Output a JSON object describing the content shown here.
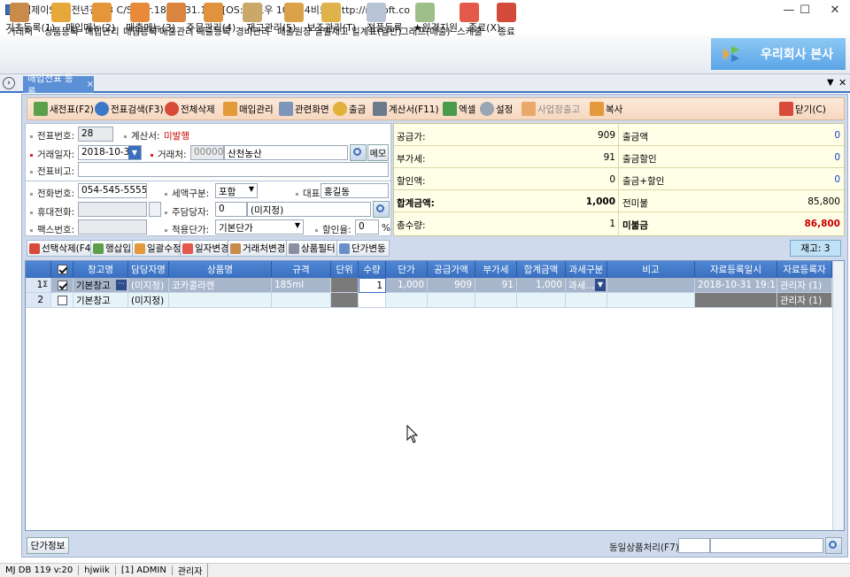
{
  "window": {
    "title": "엠제이Soft 전년경영3 C/S   Ver.18.10.31.179  [OS: 윈도우 10 - 64비트]   http://mjsoft.co"
  },
  "menu": [
    "기초등록(1)",
    "매입메뉴(2)",
    "매출메뉴(3)",
    "주문관리(4)",
    "재고관리(5)",
    "보조관리(T)",
    "정품등록",
    "★원격지원",
    "종료(X)"
  ],
  "toolbar": [
    "거래처",
    "상품등록",
    "매입관리",
    "매입등록",
    "매출관리",
    "매출등록",
    "경비관리",
    "매출원장",
    "일별재고",
    "일계표(일반)",
    "그래프(매출)",
    "스케줄",
    "종료"
  ],
  "brand": {
    "label": "우리회사 본사"
  },
  "tab": {
    "label": "매입전표 등록",
    "close": "×"
  },
  "form_toolbar": [
    "새전표(F2)",
    "전표검색(F3)",
    "전체삭제",
    "매입관리",
    "관련화면",
    "출금",
    "계산서(F11)",
    "엑셀",
    "설정",
    "사업장출고",
    "복사",
    "닫기(C)"
  ],
  "form": {
    "voucher_no_label": "전표번호:",
    "voucher_no": "28",
    "invoice_label": "계산서:",
    "invoice_status": "미발행",
    "date_label": "거래일자:",
    "date": "2018-10-31",
    "vendor_label": "거래처:",
    "vendor_code": "000001",
    "vendor_name": "산천농산",
    "memo_btn": "메모",
    "note_label": "전표비고:",
    "note": "",
    "phone_label": "전화번호:",
    "phone": "054-545-5555",
    "tax_type_label": "세액구분:",
    "tax_type": "포함",
    "rep_label": "대표자:",
    "rep": "홍길동",
    "mobile_label": "휴대전화:",
    "mobile": "",
    "manager_label": "주담당자:",
    "manager_code": "0",
    "manager_name": "(미지정)",
    "fax_label": "팩스번호:",
    "fax": "",
    "price_type_label": "적용단가:",
    "price_type": "기본단가",
    "discount_label": "할인율:",
    "discount": "0",
    "percent": "%"
  },
  "summary": [
    {
      "left_label": "공급가:",
      "left_value": "909",
      "right_label": "출금액",
      "right_value": "0"
    },
    {
      "left_label": "부가세:",
      "left_value": "91",
      "right_label": "출금할인",
      "right_value": "0"
    },
    {
      "left_label": "할인액:",
      "left_value": "0",
      "right_label": "출금+할인",
      "right_value": "0"
    },
    {
      "left_label": "합계금액:",
      "left_value": "1,000",
      "right_label": "전미불",
      "right_value": "85,800"
    },
    {
      "left_label": "총수량:",
      "left_value": "1",
      "right_label": "미불금",
      "right_value": "86,800"
    }
  ],
  "actions": [
    "선택삭제(F4)",
    "행삽입",
    "일괄수정",
    "일자변경",
    "거래처변경",
    "상품필터",
    "단가변동"
  ],
  "stock": "재고: 3",
  "grid": {
    "headers": [
      "",
      "",
      "창고명",
      "담당자명",
      "상품명",
      "규격",
      "단위",
      "수량",
      "단가",
      "공급가액",
      "부가세",
      "합계금액",
      "과세구분",
      "비고",
      "자료등록일시",
      "자료등록자"
    ],
    "rows": [
      {
        "no": "1",
        "mark": "Σ",
        "checked": true,
        "warehouse": "기본창고",
        "manager": "(미지정)",
        "product": "코카콜라캔",
        "spec": "185ml",
        "unit": "",
        "qty": "1",
        "price": "1,000",
        "supply": "909",
        "vat": "91",
        "total": "1,000",
        "tax": "과세...",
        "note": "",
        "reg_date": "2018-10-31 19:11:05",
        "reg_user": "관리자 (1)"
      },
      {
        "no": "2",
        "mark": "",
        "checked": false,
        "warehouse": "기본창고",
        "manager": "(미지정)",
        "product": "",
        "spec": "",
        "unit": "",
        "qty": "",
        "price": "",
        "supply": "",
        "vat": "",
        "total": "",
        "tax": "",
        "note": "",
        "reg_date": "",
        "reg_user": "관리자 (1)"
      }
    ]
  },
  "bottom": {
    "price_info": "단가정보",
    "same_item_label": "동일상품처리(F7):"
  },
  "status": [
    "MJ DB 119 v:20",
    "hjwiik",
    "[1] ADMIN",
    "관리자"
  ],
  "colors": {
    "accent": "#3a6fbf",
    "due": "#cc0000",
    "total_blue": "#1a3fc8"
  }
}
